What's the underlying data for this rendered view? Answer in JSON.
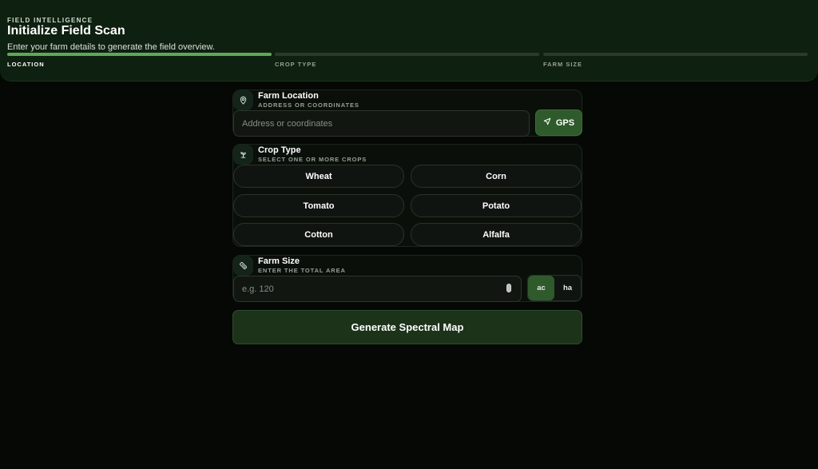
{
  "header": {
    "eyebrow": "FIELD INTELLIGENCE",
    "title": "Initialize Field Scan",
    "subtitle": "Enter your farm details to generate the field overview."
  },
  "steps": [
    {
      "label": "LOCATION",
      "active": true
    },
    {
      "label": "CROP TYPE",
      "active": false
    },
    {
      "label": "FARM SIZE",
      "active": false
    }
  ],
  "location": {
    "icon": "map-pin-icon",
    "title": "Farm Location",
    "subtitle": "ADDRESS OR COORDINATES",
    "placeholder": "Address or coordinates",
    "value": "",
    "gps_label": "GPS",
    "gps_icon": "navigation-arrow-icon"
  },
  "crops": {
    "icon": "sprout-icon",
    "title": "Crop Type",
    "subtitle": "SELECT ONE OR MORE CROPS",
    "options": [
      "Wheat",
      "Corn",
      "Tomato",
      "Potato",
      "Cotton",
      "Alfalfa"
    ]
  },
  "size": {
    "icon": "ruler-icon",
    "title": "Farm Size",
    "subtitle": "ENTER THE TOTAL AREA",
    "placeholder": "e.g. 120",
    "value": "",
    "units": [
      "ac",
      "ha"
    ],
    "selected_unit": "ac"
  },
  "generate_label": "Generate Spectral Map",
  "colors": {
    "accent": "#5fa85a",
    "button_green": "#2f5a2b",
    "header_bg": "#0e200f",
    "page_bg": "#050805"
  }
}
